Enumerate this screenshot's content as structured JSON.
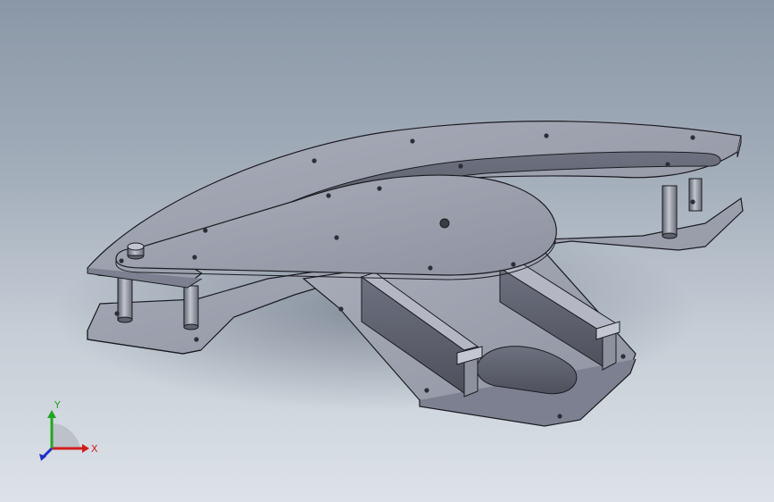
{
  "viewport": {
    "background_top": "#8a97a6",
    "background_bottom": "#dde2e8",
    "model_color": "#9da0ad",
    "edge_color": "#1b1b22"
  },
  "triad": {
    "x_label": "X",
    "y_label": "Y",
    "x_color": "#d11d1d",
    "y_color": "#1fa81f",
    "z_color": "#1f2fcf"
  }
}
